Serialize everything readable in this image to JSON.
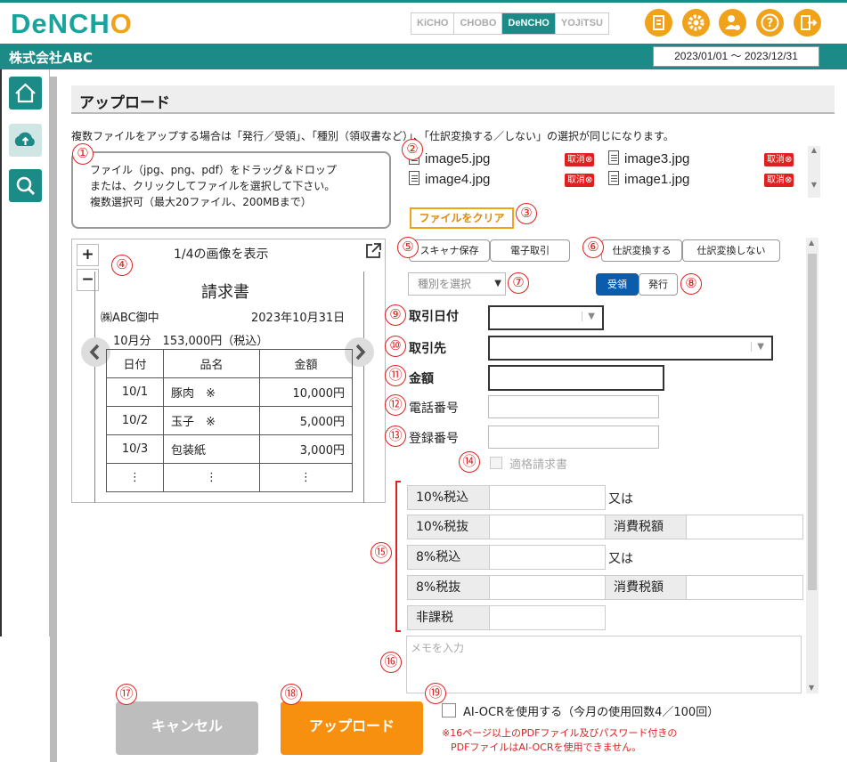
{
  "header": {
    "logo_main": "DeNCH",
    "logo_accent": "O",
    "tabs": [
      "KiCHO",
      "CHOBO",
      "DeNCHO",
      "YOJiTSU"
    ],
    "active_tab": "DeNCHO",
    "company": "株式会社ABC",
    "period": "2023/01/01 ～ 2023/12/31"
  },
  "sidebar": {
    "items": [
      "home-icon",
      "cloud-upload-icon",
      "search-icon"
    ],
    "selected": "cloud-upload-icon"
  },
  "page": {
    "title": "アップロード",
    "notice": "複数ファイルをアップする場合は「発行／受領」、「種別（領収書など）」、「仕訳変換する／しない」の選択が同じになります。"
  },
  "dropzone": {
    "line1": "ファイル（jpg、png、pdf）をドラッグ＆ドロップ",
    "line2": "または、クリックしてファイルを選択して下さい。",
    "line3": "複数選択可（最大20ファイル、200MBまで）"
  },
  "files": [
    "image5.jpg",
    "image3.jpg",
    "image4.jpg",
    "image1.jpg"
  ],
  "file_cancel_label": "取消",
  "clear_button": "ファイルをクリア",
  "viewer": {
    "caption": "1/4の画像を表示",
    "zoom_in": "+",
    "zoom_out": "−",
    "doc_title": "請求書",
    "addressee": "㈱ABC御中",
    "date": "2023年10月31日",
    "amount_line": "10月分　153,000円（税込）",
    "headers": [
      "日付",
      "品名",
      "金額"
    ],
    "rows": [
      [
        "10/1",
        "豚肉　※",
        "10,000円"
      ],
      [
        "10/2",
        "玉子　※",
        "5,000円"
      ],
      [
        "10/3",
        "包装紙",
        "3,000円"
      ],
      [
        "⋮",
        "⋮",
        "⋮"
      ]
    ]
  },
  "storage": {
    "options": [
      "スキャナ保存",
      "電子取引"
    ]
  },
  "journal": {
    "options": [
      "仕訳変換する",
      "仕訳変換しない"
    ]
  },
  "doc_type": {
    "placeholder": "種別を選択"
  },
  "direction": {
    "options": [
      "受領",
      "発行"
    ],
    "selected": "受領"
  },
  "form": {
    "date_label": "取引日付",
    "partner_label": "取引先",
    "amount_label": "金額",
    "phone_label": "電話番号",
    "reg_label": "登録番号",
    "qualified_label": "適格請求書"
  },
  "tax": {
    "r10_incl": "10%税込",
    "or1": "又は",
    "r10_excl": "10%税抜",
    "tax1": "消費税額",
    "r8_incl": "8%税込",
    "or2": "又は",
    "r8_excl": "8%税抜",
    "tax2": "消費税額",
    "nontax": "非課税"
  },
  "memo": {
    "placeholder": "メモを入力"
  },
  "buttons": {
    "cancel": "キャンセル",
    "upload": "アップロード"
  },
  "ocr": {
    "label": "AI-OCRを使用する（今月の使用回数4／100回）",
    "warn1": "※16ページ以上のPDFファイル及びパスワード付きの",
    "warn2": "PDFファイルはAI-OCRを使用できません。"
  },
  "markers": [
    "①",
    "②",
    "③",
    "④",
    "⑤",
    "⑥",
    "⑦",
    "⑧",
    "⑨",
    "⑩",
    "⑪",
    "⑫",
    "⑬",
    "⑭",
    "⑮",
    "⑯",
    "⑰",
    "⑱",
    "⑲"
  ],
  "colors": {
    "teal": "#1c8a86",
    "orange": "#f0a21a",
    "cancel_red": "#e02020",
    "selected_blue": "#0b5cad",
    "upload_orange": "#f7900f",
    "disabled_gray": "#bdbdbd"
  }
}
